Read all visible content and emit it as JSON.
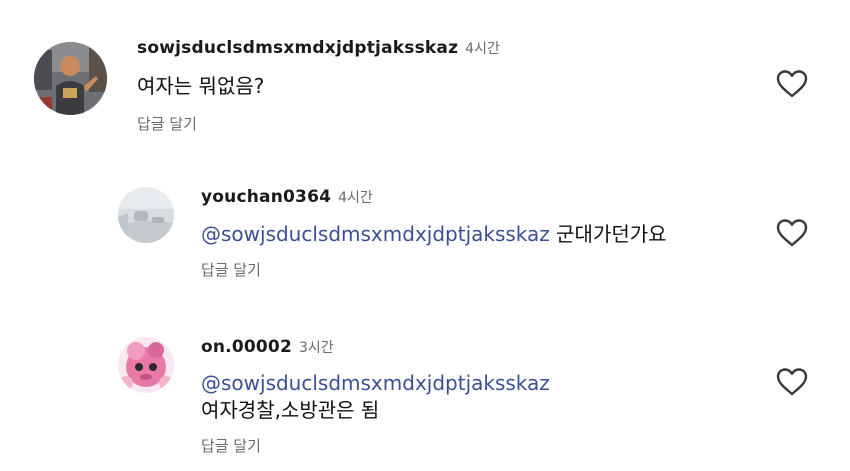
{
  "comments": [
    {
      "username": "sowjsduclsdmsxmdxjdptjaksskaz",
      "time": "4시간",
      "mention": "",
      "text": "여자는 뭐없음?",
      "reply_label": "답글 달기"
    },
    {
      "username": "youchan0364",
      "time": "4시간",
      "mention": "@sowjsduclsdmsxmdxjdptjaksskaz",
      "text": "군대가던가요",
      "reply_label": "답글 달기"
    },
    {
      "username": "on.00002",
      "time": "3시간",
      "mention": "@sowjsduclsdmsxmdxjdptjaksskaz",
      "text": "여자경찰,소방관은 됨",
      "reply_label": "답글 달기"
    }
  ],
  "colors": {
    "mention": "#3b4f93",
    "secondary_text": "#6b6b6b",
    "primary_text": "#111111",
    "icon_stroke": "#3a3a3a"
  },
  "icons": {
    "like": "heart-outline-icon"
  }
}
